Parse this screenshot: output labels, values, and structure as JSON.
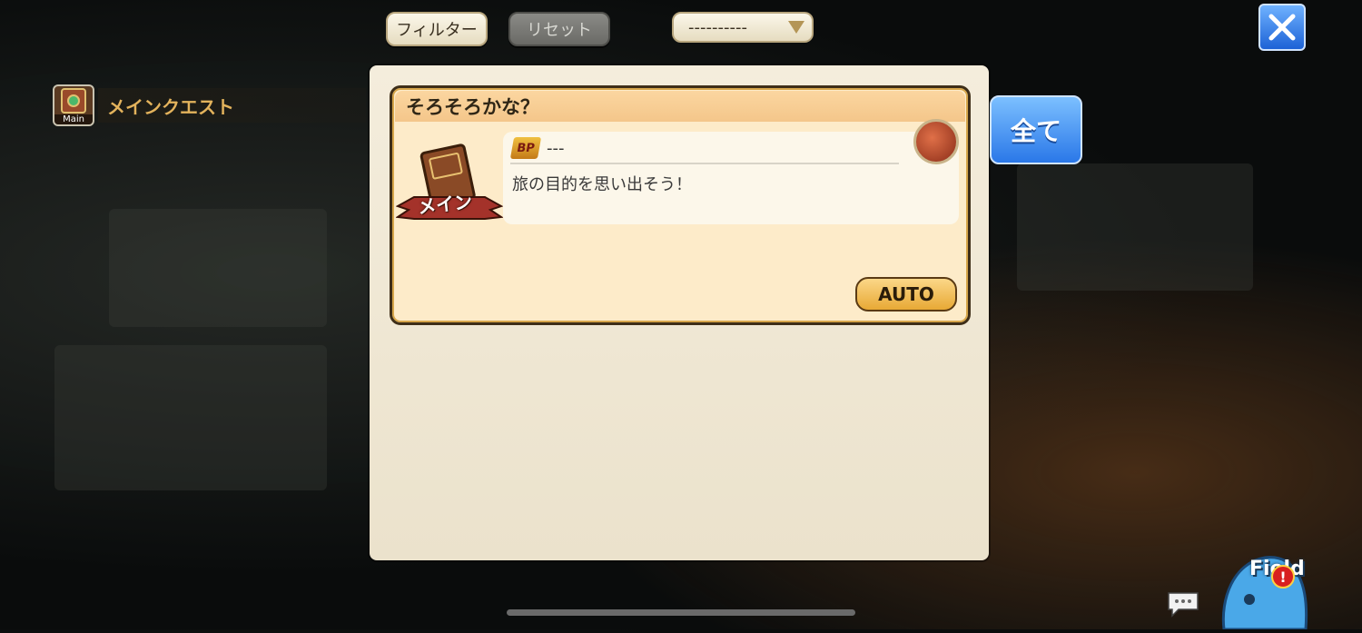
{
  "toolbar": {
    "filter_label": "フィルター",
    "reset_label": "リセット",
    "sort_value": "----------",
    "close_icon": "close-x-icon"
  },
  "sidebar": {
    "items": [
      {
        "label": "メインクエスト",
        "icon_caption": "Main",
        "icon": "main-quest-book-icon"
      }
    ]
  },
  "quest": {
    "title": "そろそろかな？",
    "emblem_label": "メイン",
    "bp_label": "BP",
    "bp_value": "---",
    "description": "旅の目的を思い出そう！",
    "reward_icon": "reward-item-icon",
    "auto_label": "AUTO"
  },
  "all_button_label": "全て",
  "field_button": {
    "label": "Field",
    "alert_icon": "exclamation-icon"
  },
  "chat_icon": "chat-bubble-icon",
  "colors": {
    "accent_blue": "#2a78e8",
    "gold": "#e8a935",
    "sidebar_label": "#e3b35c"
  }
}
